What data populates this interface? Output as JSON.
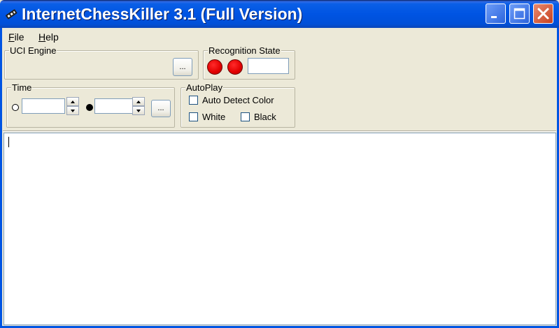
{
  "window": {
    "title": "InternetChessKiller 3.1 (Full Version)",
    "title_bar_color": "#0054E3"
  },
  "titlebar_buttons": {
    "minimize_icon": "minimize-icon",
    "maximize_icon": "maximize-icon",
    "close_icon": "close-icon"
  },
  "menu": {
    "file": {
      "mnemonic": "F",
      "rest": "ile"
    },
    "help": {
      "mnemonic": "H",
      "rest": "elp"
    }
  },
  "uci_engine": {
    "title": "UCI Engine",
    "browse_label": "..."
  },
  "recognition_state": {
    "title": "Recognition State",
    "indicator_color": "#E10000",
    "value": ""
  },
  "time": {
    "title": "Time",
    "white_value": "",
    "black_value": "",
    "browse_label": "..."
  },
  "autoplay": {
    "title": "AutoPlay",
    "auto_detect_label": "Auto Detect Color",
    "auto_detect_checked": false,
    "white_label": "White",
    "white_checked": false,
    "black_label": "Black",
    "black_checked": false
  },
  "log": {
    "text": ""
  }
}
